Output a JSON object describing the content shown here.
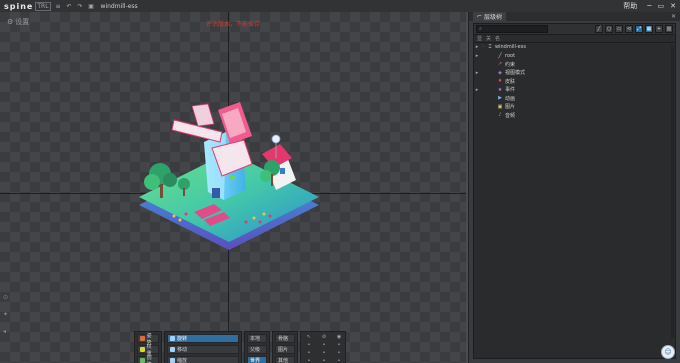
{
  "app": {
    "logo_text": "spine",
    "logo_trial": "TRL",
    "file_name": "windmill-ess",
    "help_label": "帮助",
    "min_icon": "─",
    "max_icon": "▭",
    "close_icon": "✕"
  },
  "viewport": {
    "mode_label": "设置",
    "trial_warning": "评估版本，不能保存"
  },
  "panel": {
    "title": "层级树",
    "search_placeholder": "",
    "header_cols": [
      "显",
      "关",
      "名"
    ],
    "tree": [
      {
        "label": "windmill-ess",
        "indent": 0,
        "icon": "skeleton",
        "expanded": true
      },
      {
        "label": "root",
        "indent": 1,
        "icon": "bone",
        "expanded": true
      },
      {
        "label": "约束",
        "indent": 1,
        "icon": "constraint",
        "expanded": false
      },
      {
        "label": "视图模式",
        "indent": 1,
        "icon": "view",
        "expanded": true
      },
      {
        "label": "皮肤",
        "indent": 1,
        "icon": "skin",
        "expanded": false
      },
      {
        "label": "事件",
        "indent": 1,
        "icon": "event",
        "expanded": true
      },
      {
        "label": "动画",
        "indent": 1,
        "icon": "anim",
        "expanded": false
      },
      {
        "label": "图片",
        "indent": 1,
        "icon": "images",
        "expanded": false
      },
      {
        "label": "音频",
        "indent": 1,
        "icon": "audio",
        "expanded": false
      }
    ]
  },
  "toolbar": {
    "left": [
      "姿势",
      "权重",
      "创建"
    ],
    "mid": [
      "旋转",
      "移动",
      "缩放",
      "剪切"
    ],
    "right1": [
      "本地",
      "父级",
      "世界"
    ],
    "right2": [
      "骨骼",
      "图片",
      "其他"
    ],
    "opt_rows": [
      "骨骼",
      "图片",
      "其他"
    ]
  }
}
